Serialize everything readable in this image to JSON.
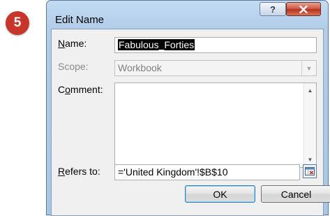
{
  "step_badge": "5",
  "window": {
    "title": "Edit Name"
  },
  "titlebar": {
    "help_label": "?"
  },
  "form": {
    "name": {
      "label_u": "N",
      "label_rest": "ame:",
      "value": "Fabulous_Forties"
    },
    "scope": {
      "label": "Scope:",
      "value": "Workbook"
    },
    "comment": {
      "label_pre": "C",
      "label_u": "o",
      "label_rest": "mment:",
      "value": ""
    },
    "refers_to": {
      "label_u": "R",
      "label_rest": "efers to:",
      "value": "='United Kingdom'!$B$10"
    }
  },
  "buttons": {
    "ok": "OK",
    "cancel": "Cancel"
  },
  "colors": {
    "badge": "#c8362b",
    "close": "#c0452d",
    "selection": "#000000"
  }
}
